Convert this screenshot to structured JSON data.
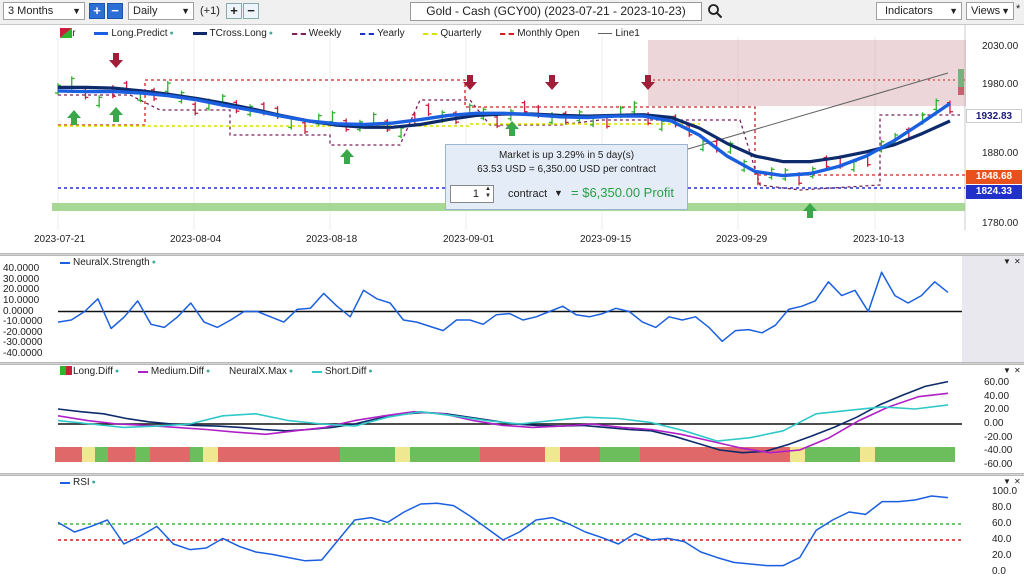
{
  "toolbar": {
    "period": "3 Months",
    "interval": "Daily",
    "offset": "(+1)",
    "symbol_title": "Gold - Cash (GCY00) (2023-07-21 - 2023-10-23)",
    "indicators_label": "Indicators",
    "views_label": "Views",
    "views_star": "*"
  },
  "colors": {
    "long_predict": "#1a5fe0",
    "tcross_long": "#0d2a6b",
    "weekly": "#7a1f5c",
    "yearly": "#2030d0",
    "quarterly": "#d8e000",
    "monthly_open": "#d02020",
    "line1": "#606060",
    "up_bar": "#2db32d",
    "down_bar": "#c81e3c"
  },
  "legend_main": [
    {
      "label": "Bar",
      "icon": "bar-icon"
    },
    {
      "label": "Long.Predict",
      "color": "#1a5fe0",
      "style": "solid"
    },
    {
      "label": "TCross.Long",
      "color": "#0d2a6b",
      "style": "solid"
    },
    {
      "label": "Weekly",
      "color": "#7a1f5c",
      "style": "dashed"
    },
    {
      "label": "Yearly",
      "color": "#2030d0",
      "style": "dashed"
    },
    {
      "label": "Quarterly",
      "color": "#d8e000",
      "style": "dashed"
    },
    {
      "label": "Monthly Open",
      "color": "#d02020",
      "style": "dashed"
    },
    {
      "label": "Line1",
      "color": "#606060",
      "style": "solid"
    }
  ],
  "price_axis": [
    "2030.00",
    "1980.00",
    "1880.00",
    "1780.00"
  ],
  "price_tags": {
    "long_predict": "1932.83",
    "monthly_open": "1848.68",
    "yearly": "1824.33"
  },
  "date_axis": [
    "2023-07-21",
    "2023-08-04",
    "2023-08-18",
    "2023-09-01",
    "2023-09-15",
    "2023-09-29",
    "2023-10-13"
  ],
  "popup": {
    "line1": "Market is up 3.29% in 5 day(s)",
    "line2": "63.53 USD = 6,350.00 USD per contract",
    "quantity": "1",
    "contract_label": "contract",
    "equals": "=",
    "profit": "$6,350.00 Profit"
  },
  "strength_pane": {
    "legend": "NeuralX.Strength",
    "axis": [
      "40.0000",
      "30.0000",
      "20.0000",
      "10.0000",
      "0.0000",
      "-10.0000",
      "-20.0000",
      "-30.0000",
      "-40.0000"
    ]
  },
  "diff_pane": {
    "legend": [
      {
        "label": "Long.Diff",
        "color": "#0d2a6b"
      },
      {
        "label": "Medium.Diff",
        "color": "#b020c8"
      },
      {
        "label": "NeuralX.Max",
        "icon": "neuralx-max-icon"
      },
      {
        "label": "Short.Diff",
        "color": "#30c8c8"
      }
    ],
    "axis": [
      "60.00",
      "40.00",
      "20.00",
      "0.00",
      "-20.00",
      "-40.00",
      "-60.00"
    ]
  },
  "rsi_pane": {
    "legend": "RSI",
    "axis": [
      "100.0",
      "80.0",
      "60.0",
      "40.0",
      "20.0",
      "0.0"
    ]
  },
  "chart_data": [
    {
      "type": "bar",
      "title": "Gold - Cash (GCY00) (2023-07-21 - 2023-10-23)",
      "x_range": [
        "2023-07-21",
        "2023-10-23"
      ],
      "ylim": [
        1760,
        2040
      ],
      "series": [
        {
          "name": "Long.Predict",
          "values": [
            1963,
            1962,
            1962,
            1960,
            1956,
            1950,
            1942,
            1935,
            1927,
            1920,
            1916,
            1915,
            1917,
            1922,
            1928,
            1931,
            1931,
            1929,
            1926,
            1925,
            1927,
            1927,
            1920,
            1900,
            1870,
            1848,
            1842,
            1845,
            1855,
            1870,
            1892,
            1918,
            1945
          ]
        },
        {
          "name": "TCross.Long",
          "values": [
            1968,
            1968,
            1967,
            1963,
            1958,
            1952,
            1945,
            1937,
            1928,
            1920,
            1914,
            1911,
            1911,
            1915,
            1922,
            1928,
            1930,
            1930,
            1928,
            1927,
            1928,
            1929,
            1925,
            1910,
            1888,
            1870,
            1862,
            1862,
            1868,
            1876,
            1886,
            1902,
            1920
          ]
        },
        {
          "name": "Yearly",
          "values": [
            1824.33
          ]
        },
        {
          "name": "Monthly Open",
          "values": [
            1848.68
          ]
        }
      ]
    },
    {
      "type": "line",
      "title": "NeuralX.Strength",
      "ylim": [
        -40,
        40
      ],
      "series": [
        {
          "name": "NeuralX.Strength",
          "values": [
            -10,
            -8,
            0,
            12,
            -16,
            -5,
            10,
            -12,
            -15,
            -5,
            8,
            -10,
            -15,
            -8,
            0,
            0,
            -5,
            -10,
            2,
            3,
            17,
            5,
            -5,
            20,
            12,
            8,
            -8,
            -10,
            -14,
            -18,
            -8,
            -8,
            -12,
            -3,
            -2,
            -8,
            -5,
            0,
            5,
            -3,
            -5,
            -2,
            3,
            0,
            -10,
            -15,
            -5,
            -8,
            -5,
            -15,
            -28,
            -18,
            -17,
            -20,
            -13,
            2,
            5,
            10,
            28,
            15,
            20,
            0,
            37,
            15,
            8,
            15,
            28,
            18
          ]
        }
      ]
    },
    {
      "type": "line",
      "title": "Diff",
      "ylim": [
        -60,
        60
      ],
      "series": [
        {
          "name": "Long.Diff",
          "values": [
            22,
            18,
            15,
            8,
            3,
            0,
            -2,
            -3,
            -5,
            -8,
            -10,
            -8,
            -5,
            0,
            8,
            14,
            17,
            15,
            10,
            5,
            0,
            -2,
            -3,
            -2,
            -5,
            -8,
            -10,
            -18,
            -28,
            -38,
            -42,
            -40,
            -30,
            -18,
            -5,
            10,
            28,
            42,
            55,
            62
          ]
        },
        {
          "name": "Medium.Diff",
          "values": [
            12,
            5,
            0,
            -2,
            -5,
            -8,
            -12,
            -15,
            -10,
            -5,
            5,
            12,
            18,
            15,
            5,
            -2,
            -5,
            -3,
            0,
            -5,
            -8,
            -15,
            -25,
            -35,
            -42,
            -38,
            -20,
            5,
            25,
            40,
            45
          ]
        },
        {
          "name": "Short.Diff",
          "values": [
            5,
            0,
            -5,
            -3,
            0,
            12,
            15,
            5,
            0,
            -3,
            10,
            18,
            12,
            5,
            0,
            5,
            10,
            8,
            2,
            -10,
            -25,
            -20,
            -10,
            15,
            20,
            25,
            22,
            28
          ]
        }
      ]
    },
    {
      "type": "line",
      "title": "RSI",
      "ylim": [
        0,
        100
      ],
      "series": [
        {
          "name": "RSI",
          "values": [
            62,
            50,
            57,
            65,
            35,
            45,
            57,
            35,
            28,
            30,
            42,
            32,
            25,
            22,
            18,
            14,
            15,
            40,
            65,
            68,
            62,
            75,
            85,
            86,
            83,
            70,
            55,
            40,
            50,
            65,
            68,
            60,
            50,
            43,
            35,
            48,
            40,
            42,
            38,
            25,
            18,
            12,
            10,
            8,
            8,
            18,
            52,
            65,
            75,
            72,
            88,
            88,
            90,
            95,
            93
          ]
        }
      ]
    }
  ]
}
